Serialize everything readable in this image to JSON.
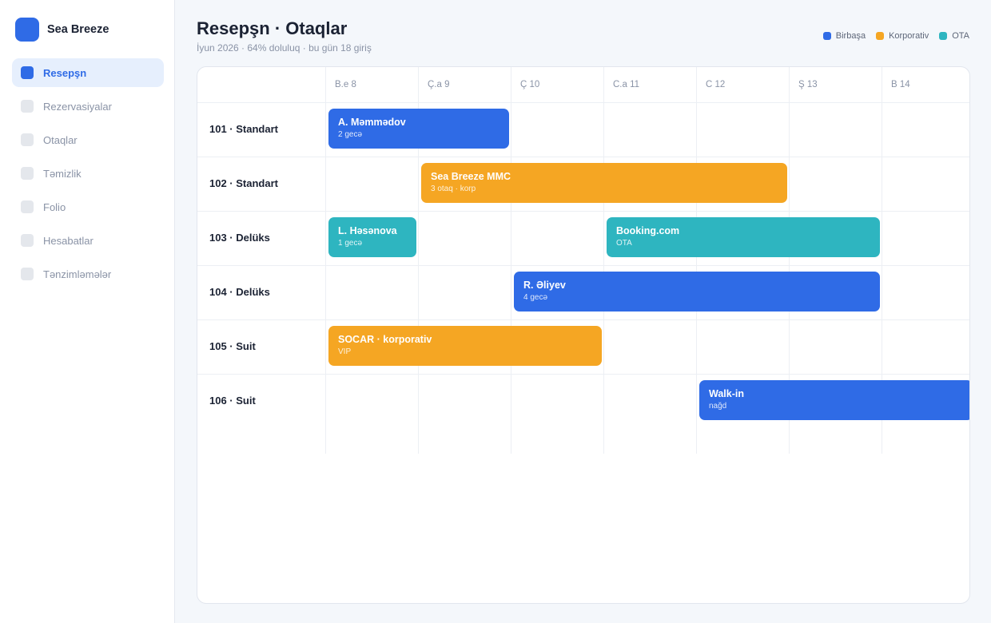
{
  "brand": {
    "name": "Sea Breeze"
  },
  "sidebar": {
    "items": [
      {
        "label": "Resepşn",
        "active": true
      },
      {
        "label": "Rezervasiyalar",
        "active": false
      },
      {
        "label": "Otaqlar",
        "active": false
      },
      {
        "label": "Təmizlik",
        "active": false
      },
      {
        "label": "Folio",
        "active": false
      },
      {
        "label": "Hesabatlar",
        "active": false
      },
      {
        "label": "Tənzimləmələr",
        "active": false
      }
    ]
  },
  "header": {
    "title": "Resepşn · Otaqlar",
    "subtitle": "İyun 2026 · 64% doluluq · bu gün 18 giriş"
  },
  "legend": [
    {
      "label": "Birbaşa",
      "color": "#2f6be6"
    },
    {
      "label": "Korporativ",
      "color": "#f5a623"
    },
    {
      "label": "OTA",
      "color": "#2eb5c0"
    }
  ],
  "days": [
    "B.e 8",
    "Ç.a 9",
    "Ç 10",
    "C.a 11",
    "C 12",
    "Ş 13",
    "B 14"
  ],
  "rooms": [
    "101 · Standart",
    "102 · Standart",
    "103 · Delüks",
    "104 · Delüks",
    "105 · Suit",
    "106 · Suit"
  ],
  "bookings": [
    {
      "room": 0,
      "start": 0,
      "nights": 2,
      "channel": "direct",
      "name": "A. Məmmədov",
      "note": "2 gecə"
    },
    {
      "room": 1,
      "start": 1,
      "nights": 4,
      "channel": "corp",
      "name": "Sea Breeze MMC",
      "note": "3 otaq · korp"
    },
    {
      "room": 2,
      "start": 0,
      "nights": 1,
      "channel": "ota",
      "name": "L. Həsənova",
      "note": "1 gecə"
    },
    {
      "room": 2,
      "start": 3,
      "nights": 3,
      "channel": "ota",
      "name": "Booking.com",
      "note": "OTA"
    },
    {
      "room": 3,
      "start": 2,
      "nights": 4,
      "channel": "direct",
      "name": "R. Əliyev",
      "note": "4 gecə"
    },
    {
      "room": 4,
      "start": 0,
      "nights": 3,
      "channel": "corp",
      "name": "SOCAR · korporativ",
      "note": "VIP"
    },
    {
      "room": 5,
      "start": 4,
      "nights": 3,
      "channel": "direct",
      "name": "Walk-in",
      "note": "nağd"
    }
  ]
}
